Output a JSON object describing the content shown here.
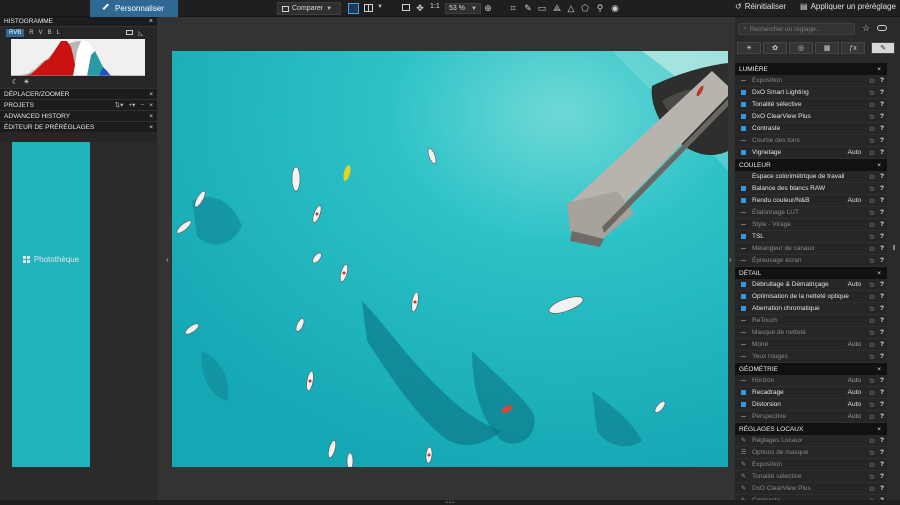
{
  "topbar": {
    "tabs": [
      {
        "label": "Photothèque",
        "icon": "grid-icon"
      },
      {
        "label": "Personnaliser",
        "icon": "pen-icon",
        "active": true
      }
    ],
    "compare_label": "Comparer",
    "one_to_one": "1:1",
    "zoom": "53 %",
    "reset_label": "Réinitialiser",
    "apply_label": "Appliquer un préréglage"
  },
  "left": {
    "histogram_title": "HISTOGRAMME",
    "channels": [
      "RVB",
      "R",
      "V",
      "B",
      "L"
    ],
    "panels": [
      {
        "label": "DÉPLACER/ZOOMER"
      },
      {
        "label": "PROJETS"
      },
      {
        "label": "ADVANCED HISTORY"
      },
      {
        "label": "ÉDITEUR DE PRÉRÉGLAGES"
      }
    ]
  },
  "right": {
    "search_placeholder": "Rechercher un réglage...",
    "sections": [
      {
        "title": "LUMIÈRE",
        "items": [
          {
            "label": "Exposition",
            "active": false,
            "badge": ""
          },
          {
            "label": "DxO Smart Lighting",
            "active": true,
            "badge": ""
          },
          {
            "label": "Tonalité sélective",
            "active": true,
            "badge": ""
          },
          {
            "label": "DxO ClearView Plus",
            "active": true,
            "badge": ""
          },
          {
            "label": "Contraste",
            "active": true,
            "badge": ""
          },
          {
            "label": "Courbe des tons",
            "active": false,
            "badge": ""
          },
          {
            "label": "Vignetage",
            "active": true,
            "badge": "Auto"
          }
        ]
      },
      {
        "title": "COULEUR",
        "items": [
          {
            "label": "Espace colorimétrique de travail",
            "active": "none",
            "badge": ""
          },
          {
            "label": "Balance des blancs RAW",
            "active": true,
            "badge": ""
          },
          {
            "label": "Rendu couleur/N&B",
            "active": true,
            "badge": "Auto"
          },
          {
            "label": "Étalonnage LUT",
            "active": false,
            "badge": ""
          },
          {
            "label": "Style - Virage",
            "active": false,
            "badge": ""
          },
          {
            "label": "TSL",
            "active": true,
            "badge": ""
          },
          {
            "label": "Mélangeur de canaux",
            "active": false,
            "badge": ""
          },
          {
            "label": "Épreuvage écran",
            "active": false,
            "badge": ""
          }
        ]
      },
      {
        "title": "DÉTAIL",
        "items": [
          {
            "label": "Débruitage & Dématriçage",
            "active": true,
            "badge": "Auto"
          },
          {
            "label": "Optimisation de la netteté optique",
            "active": true,
            "badge": ""
          },
          {
            "label": "Aberration chromatique",
            "active": true,
            "badge": ""
          },
          {
            "label": "ReTouch",
            "active": false,
            "badge": ""
          },
          {
            "label": "Masque de netteté",
            "active": false,
            "badge": ""
          },
          {
            "label": "Moiré",
            "active": false,
            "badge": "Auto"
          },
          {
            "label": "Yeux rouges",
            "active": false,
            "badge": ""
          }
        ]
      },
      {
        "title": "GÉOMÉTRIE",
        "items": [
          {
            "label": "Horizon",
            "active": false,
            "badge": "Auto"
          },
          {
            "label": "Recadrage",
            "active": true,
            "badge": "Auto"
          },
          {
            "label": "Distorsion",
            "active": true,
            "badge": "Auto"
          },
          {
            "label": "Perspective",
            "active": false,
            "badge": "Auto"
          }
        ]
      },
      {
        "title": "RÉGLAGES LOCAUX",
        "items": [
          {
            "label": "Réglages Locaux",
            "active": false,
            "badge": "",
            "icon": "pencil-icon"
          },
          {
            "label": "Options de masque",
            "active": false,
            "badge": "",
            "icon": "sliders-icon"
          },
          {
            "label": "Exposition",
            "active": false,
            "badge": "",
            "icon": "pencil-icon"
          },
          {
            "label": "Tonalité sélective",
            "active": false,
            "badge": "",
            "icon": "pencil-icon"
          },
          {
            "label": "DxO ClearView Plus",
            "active": false,
            "badge": "",
            "icon": "pencil-icon"
          },
          {
            "label": "Contraste",
            "active": false,
            "badge": "",
            "icon": "pencil-icon"
          }
        ]
      }
    ]
  },
  "colors": {
    "accent": "#2f6893",
    "check": "#2b9be8",
    "water": "#1fb4bd"
  }
}
